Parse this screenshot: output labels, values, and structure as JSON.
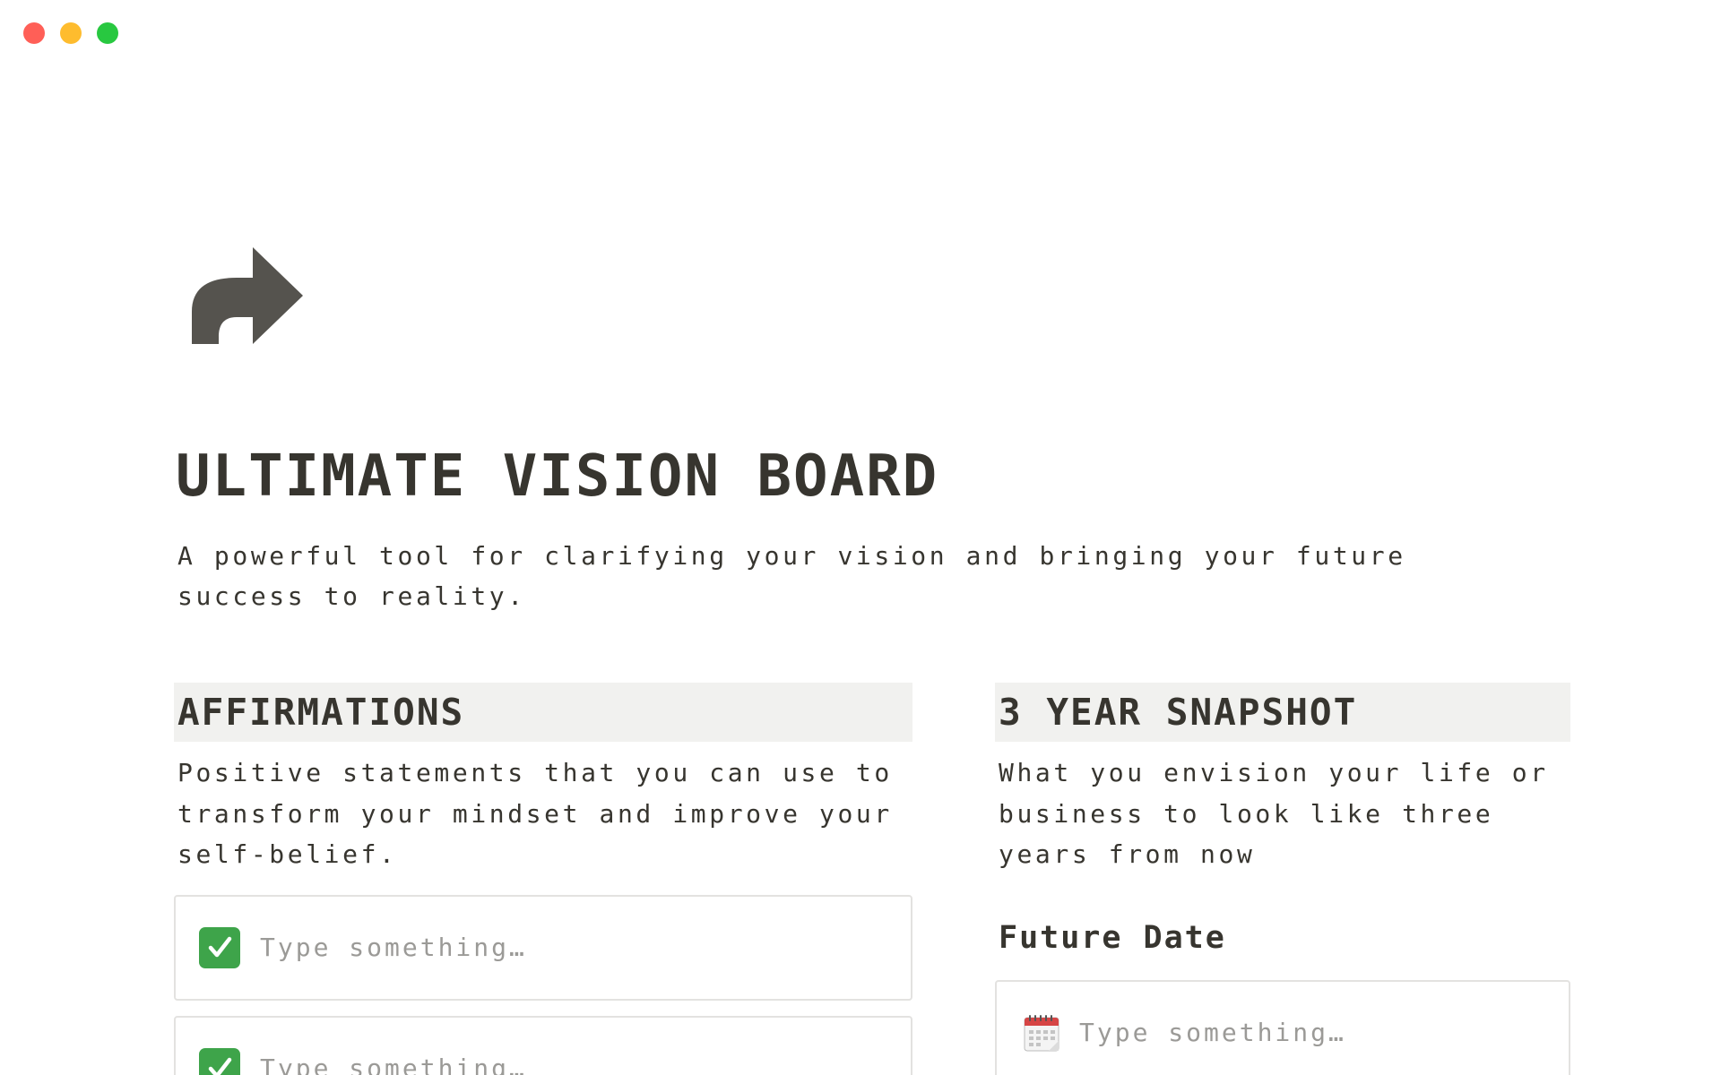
{
  "window": {
    "controls": [
      {
        "name": "close",
        "color": "#ff5f57"
      },
      {
        "name": "minimize",
        "color": "#febc2e"
      },
      {
        "name": "maximize",
        "color": "#28c840"
      }
    ]
  },
  "page": {
    "icon": "share-arrow-icon",
    "title": "ULTIMATE VISION BOARD",
    "subtitle": "A powerful tool for clarifying your vision and bringing your future success to reality."
  },
  "affirmations": {
    "heading": "AFFIRMATIONS",
    "description": "Positive statements that you can use to transform your mindset and improve your self-belief.",
    "items": [
      {
        "icon": "check-mark-icon",
        "placeholder": "Type something…"
      },
      {
        "icon": "check-mark-icon",
        "placeholder": "Type something…"
      }
    ]
  },
  "snapshot": {
    "heading": "3 YEAR SNAPSHOT",
    "description": "What you envision your life or business to look like three years from now",
    "future_date": {
      "label": "Future Date",
      "icon": "calendar-icon",
      "placeholder": "Type something…"
    }
  },
  "colors": {
    "text": "#37352f",
    "placeholder": "#9b9a97",
    "heading_bg": "#f1f1ef",
    "border": "#e3e2e0",
    "check": "#3ea44a",
    "icon": "#55534e"
  }
}
